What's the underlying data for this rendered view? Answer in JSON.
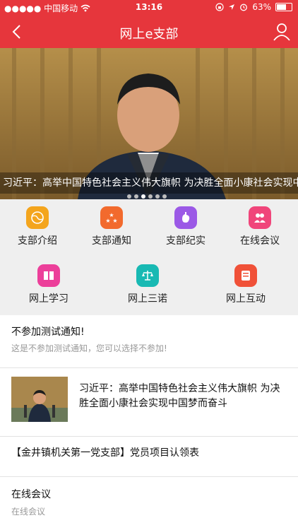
{
  "status": {
    "carrier": "●●●●● 中国移动",
    "time": "13:16",
    "battery": "63%",
    "battery_level": 0.63
  },
  "nav": {
    "title": "网上e支部"
  },
  "banner": {
    "caption": "习近平：高举中国特色社会主义伟大旗帜 为决胜全面小康社会实现中国",
    "dots_count": 6,
    "active_dot": 2
  },
  "grid": {
    "row1": [
      {
        "label": "支部介绍",
        "icon": "globe-icon",
        "color": "#f4a51d"
      },
      {
        "label": "支部通知",
        "icon": "stars-icon",
        "color": "#f26a2d"
      },
      {
        "label": "支部纪实",
        "icon": "hand-icon",
        "color": "#9b59e6"
      },
      {
        "label": "在线会议",
        "icon": "people-icon",
        "color": "#f0457a"
      }
    ],
    "row2": [
      {
        "label": "网上学习",
        "icon": "book-icon",
        "color": "#ec3f9a"
      },
      {
        "label": "网上三诺",
        "icon": "scale-icon",
        "color": "#18b9b3"
      },
      {
        "label": "网上互动",
        "icon": "chat-icon",
        "color": "#f05138"
      }
    ]
  },
  "notice": {
    "title": "不参加测试通知!",
    "desc": "这是不参加测试通知，您可以选择不参加!"
  },
  "news": {
    "title": "习近平：高举中国特色社会主义伟大旗帜 为决胜全面小康社会实现中国梦而奋斗"
  },
  "project": {
    "title": "【金井镇机关第一党支部】党员项目认领表"
  },
  "meeting": {
    "title": "在线会议",
    "desc": "在线会议"
  }
}
